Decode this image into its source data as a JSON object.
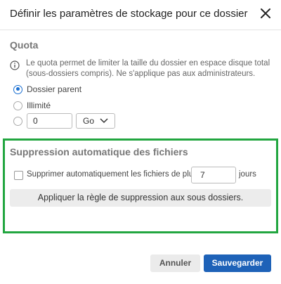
{
  "dialog": {
    "title": "Définir les paramètres de stockage pour ce dossier",
    "close_icon": "close-icon"
  },
  "quota": {
    "section_title": "Quota",
    "info_icon": "info-icon",
    "info_text": "Le quota permet de limiter la taille du dossier en espace disque total (sous-dossiers compris). Ne s'applique pas aux administrateurs.",
    "options": [
      {
        "label": "Dossier parent",
        "selected": true
      },
      {
        "label": "Illimité",
        "selected": false
      },
      {
        "label": "",
        "selected": false
      }
    ],
    "custom_value": "0",
    "unit_value": "Go"
  },
  "auto_delete": {
    "section_title": "Suppression automatique des fichiers",
    "checkbox_label": "Supprimer automatiquement les fichiers de plus de",
    "checked": false,
    "days_value": "7",
    "days_label": "jours",
    "apply_button_label": "Appliquer la règle de suppression aux sous dossiers.",
    "highlight_color": "#22a640"
  },
  "footer": {
    "cancel_label": "Annuler",
    "save_label": "Sauvegarder",
    "primary_color": "#1e62b8"
  }
}
